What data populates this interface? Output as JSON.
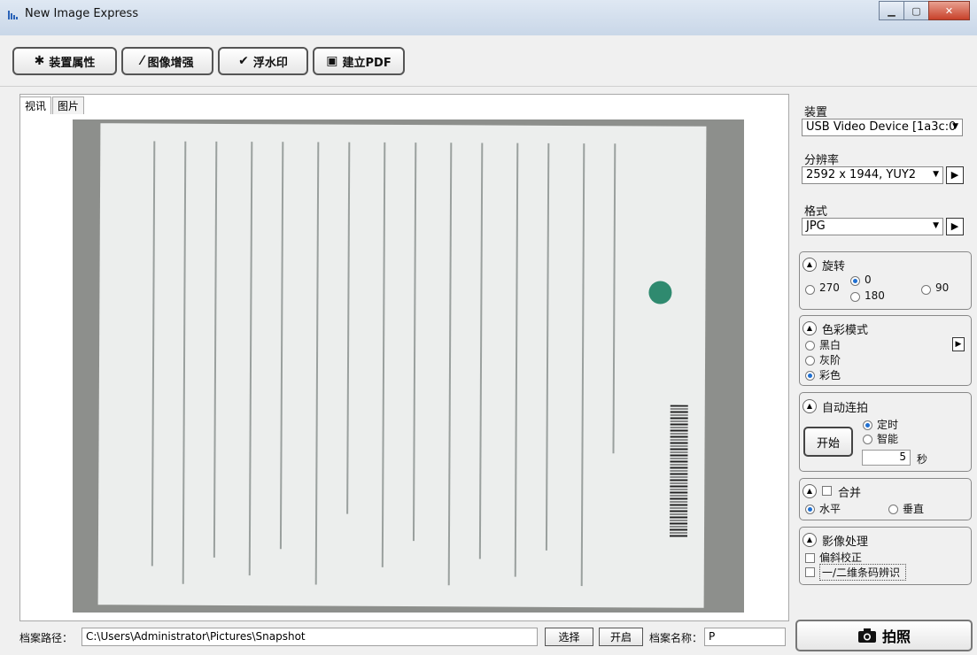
{
  "window": {
    "title": "New Image Express"
  },
  "toolbar": {
    "device_props": "装置属性",
    "enhance": "图像增强",
    "watermark": "浮水印",
    "pdf": "建立PDF"
  },
  "tabs": [
    "视讯",
    "图片"
  ],
  "panel": {
    "device_label": "装置",
    "device_value": "USB Video Device [1a3c:0",
    "resolution_label": "分辨率",
    "resolution_value": "2592 x 1944, YUY2",
    "format_label": "格式",
    "format_value": "JPG",
    "rotate": {
      "title": "旋转",
      "opt_270": "270",
      "opt_0": "0",
      "opt_180": "180",
      "opt_90": "90",
      "selected": "0"
    },
    "color": {
      "title": "色彩模式",
      "bw": "黑白",
      "gray": "灰阶",
      "color": "彩色",
      "selected": "彩色"
    },
    "auto": {
      "title": "自动连拍",
      "start": "开始",
      "timed": "定时",
      "smart": "智能",
      "seconds": "5",
      "sec_unit": "秒",
      "selected": "定时"
    },
    "merge": {
      "title": "合并",
      "horizontal": "水平",
      "vertical": "垂直",
      "selected": "水平"
    },
    "process": {
      "title": "影像处理",
      "deskew": "偏斜校正",
      "barcode": "一/二维条码辨识"
    }
  },
  "status": {
    "path_label": "档案路径：",
    "path_value": "C:\\Users\\Administrator\\Pictures\\Snapshot",
    "choose": "选择",
    "open": "开启",
    "name_label": "档案名称：",
    "name_value": "P"
  },
  "shoot": {
    "label": "拍照"
  }
}
